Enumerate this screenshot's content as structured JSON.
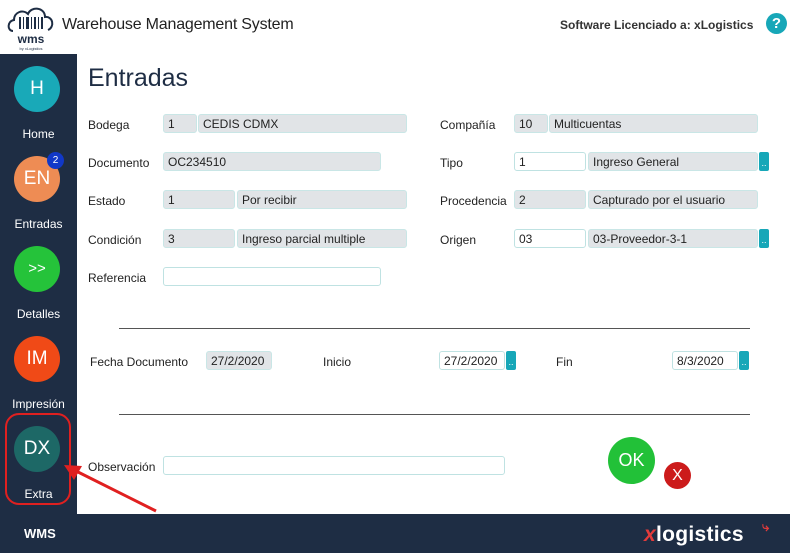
{
  "header": {
    "logo_text": "wms",
    "logo_sub": "by xLogistics",
    "app_title": "Warehouse Management System",
    "license": "Software Licenciado a: xLogistics",
    "help_label": "?"
  },
  "sidebar": {
    "items": [
      {
        "abbr": "H",
        "label": "Home",
        "color": "#19a9b8"
      },
      {
        "abbr": "EN",
        "label": "Entradas",
        "color": "#ee8c54",
        "badge": "2"
      },
      {
        "abbr": ">>",
        "label": "Detalles",
        "color": "#25c33a"
      },
      {
        "abbr": "IM",
        "label": "Impresión",
        "color": "#f04a17"
      },
      {
        "abbr": "DX",
        "label": "Extra",
        "color": "#1d6866"
      }
    ]
  },
  "page": {
    "title": "Entradas"
  },
  "form": {
    "bodega": {
      "label": "Bodega",
      "code": "1",
      "name": "CEDIS CDMX"
    },
    "compania": {
      "label": "Compañía",
      "code": "10",
      "name": "Multicuentas"
    },
    "documento": {
      "label": "Documento",
      "value": "OC234510"
    },
    "tipo": {
      "label": "Tipo",
      "code": "1",
      "name": "Ingreso General"
    },
    "estado": {
      "label": "Estado",
      "code": "1",
      "name": "Por recibir"
    },
    "procedencia": {
      "label": "Procedencia",
      "code": "2",
      "name": "Capturado por el usuario"
    },
    "condicion": {
      "label": "Condición",
      "code": "3",
      "name": "Ingreso parcial multiple"
    },
    "origen": {
      "label": "Origen",
      "code": "03",
      "name": "03-Proveedor-3-1"
    },
    "referencia": {
      "label": "Referencia",
      "value": ""
    },
    "fecha_documento": {
      "label": "Fecha Documento",
      "value": "27/2/2020"
    },
    "inicio": {
      "label": "Inicio",
      "value": "27/2/2020"
    },
    "fin": {
      "label": "Fin",
      "value": "8/3/2020"
    },
    "observacion": {
      "label": "Observación",
      "value": ""
    },
    "lookup_glyph": ".."
  },
  "actions": {
    "ok_label": "OK",
    "cancel_label": "X"
  },
  "footer": {
    "left": "WMS",
    "brand_x": "x",
    "brand_rest": "logistics"
  }
}
